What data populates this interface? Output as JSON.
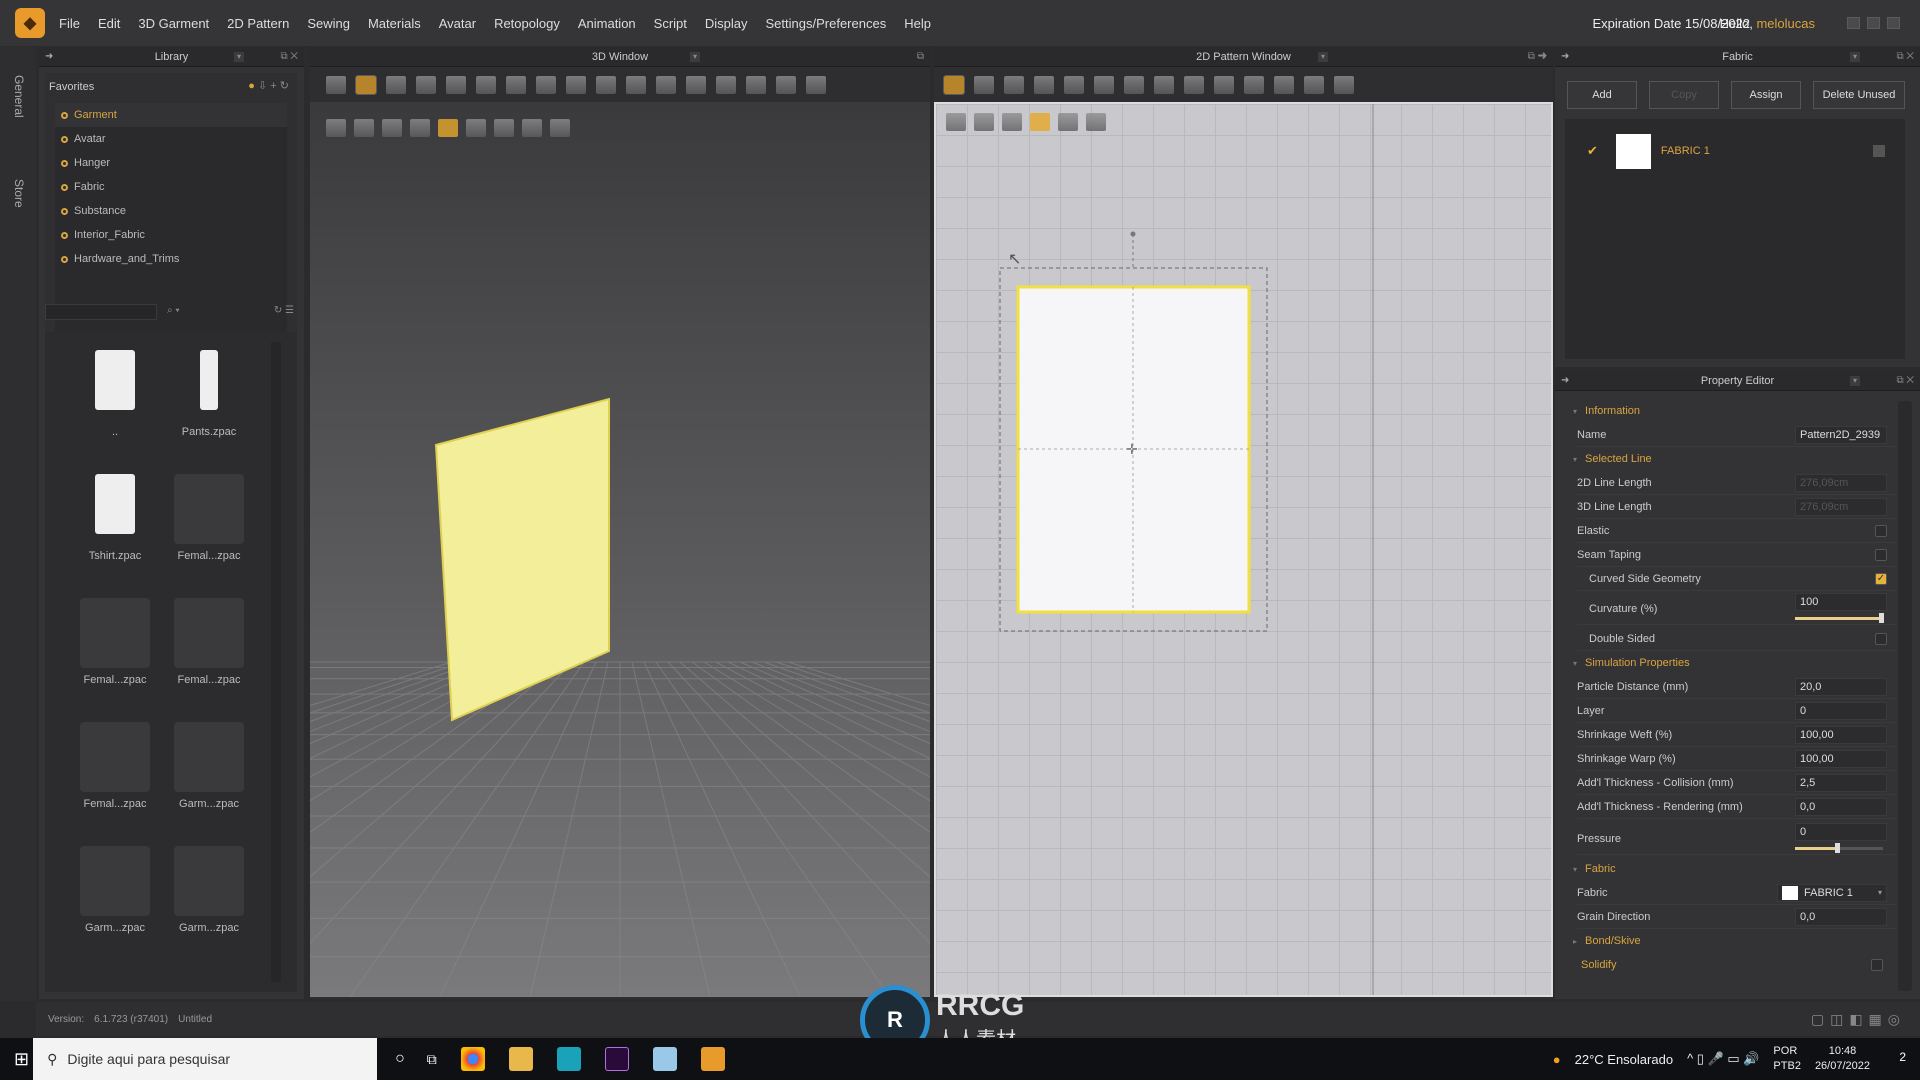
{
  "menubar": {
    "items": [
      "File",
      "Edit",
      "3D Garment",
      "2D Pattern",
      "Sewing",
      "Materials",
      "Avatar",
      "Retopology",
      "Animation",
      "Script",
      "Display",
      "Settings/Preferences",
      "Help"
    ],
    "expiration": "Expiration Date 15/08/2022",
    "hello": "Hello,",
    "username": "melolucas"
  },
  "sidetabs": {
    "general": "General",
    "store": "Store"
  },
  "library": {
    "title": "Library",
    "favorites_label": "Favorites",
    "favorites": [
      "Garment",
      "Avatar",
      "Hanger",
      "Fabric",
      "Substance",
      "Interior_Fabric",
      "Hardware_and_Trims"
    ],
    "selected_favorite": "Garment",
    "search_value": "",
    "items": [
      "..",
      "Pants.zpac",
      "Tshirt.zpac",
      "Femal...zpac",
      "Femal...zpac",
      "Femal...zpac",
      "Femal...zpac",
      "Garm...zpac",
      "Garm...zpac",
      "Garm...zpac"
    ]
  },
  "window3d": {
    "title": "3D Window",
    "toolbar1": [
      "move-down-icon",
      "transform-icon",
      "edit-point-icon",
      "edit-curve-icon",
      "fold-arrangement-icon",
      "select-mesh-icon",
      "tack-icon",
      "fold-icon",
      "strap-icon",
      "pin-icon",
      "box-pin-icon",
      "button-icon",
      "buttonhole-icon",
      "zipper-icon",
      "measure-icon",
      "avatar-measure-icon",
      "pose-icon"
    ],
    "toolbar2": [
      "texture-icon",
      "garment-icon",
      "arrangement-icon",
      "avatar-icon",
      "fabric-icon",
      "thickness-icon",
      "silhouette-icon",
      "world-icon",
      "export-icon"
    ],
    "pattern_color": "#f2ee9a"
  },
  "window2d": {
    "title": "2D Pattern Window",
    "toolbar1": [
      "transform-pattern-icon",
      "edit-point-icon",
      "rectangle-icon",
      "polygon-icon",
      "internal-shape-icon",
      "segment-sewing-icon",
      "free-sewing-icon",
      "tape-icon",
      "dart-icon",
      "pleat-icon",
      "fold-icon",
      "gusset-icon",
      "notch-icon",
      "shirt-icon"
    ],
    "toolbar2": [
      "pen-icon",
      "hide-icon",
      "zoom-icon",
      "fabric-icon",
      "grid-icon",
      "export-icon"
    ],
    "pattern_outline_color": "#f0e040"
  },
  "fabric": {
    "title": "Fabric",
    "buttons": {
      "add": "Add",
      "copy": "Copy",
      "assign": "Assign",
      "delete_unused": "Delete Unused"
    },
    "items": [
      {
        "name": "FABRIC 1",
        "selected": true,
        "swatch": "#ffffff"
      }
    ]
  },
  "property_editor": {
    "title": "Property Editor",
    "sections": {
      "information": "Information",
      "selected_line": "Selected Line",
      "simulation": "Simulation Properties",
      "fabric": "Fabric",
      "bond": "Bond/Skive",
      "solidify": "Solidify"
    },
    "name_label": "Name",
    "name_value": "Pattern2D_2939",
    "line2d_label": "2D Line Length",
    "line2d_value": "276,09cm",
    "line3d_label": "3D Line Length",
    "line3d_value": "276,09cm",
    "elastic_label": "Elastic",
    "elastic": false,
    "seam_taping_label": "Seam Taping",
    "seam_taping": false,
    "curved_label": "Curved Side Geometry",
    "curved": true,
    "curvature_label": "Curvature (%)",
    "curvature_value": "100",
    "curvature_pct": 100,
    "double_sided_label": "Double Sided",
    "double_sided": false,
    "particle_label": "Particle Distance (mm)",
    "particle_value": "20,0",
    "layer_label": "Layer",
    "layer_value": "0",
    "weft_label": "Shrinkage Weft (%)",
    "weft_value": "100,00",
    "warp_label": "Shrinkage Warp (%)",
    "warp_value": "100,00",
    "collision_label": "Add'l Thickness - Collision (mm)",
    "collision_value": "2,5",
    "rendering_label": "Add'l Thickness - Rendering (mm)",
    "rendering_value": "0,0",
    "pressure_label": "Pressure",
    "pressure_value": "0",
    "pressure_pct": 50,
    "fabric_label": "Fabric",
    "fabric_value": "FABRIC 1",
    "grain_label": "Grain Direction",
    "grain_value": "0,0",
    "solidify": false
  },
  "statusbar": {
    "version_label": "Version:",
    "version": "6.1.723 (r37401)",
    "file": "Untitled"
  },
  "taskbar": {
    "search_placeholder": "Digite aqui para pesquisar",
    "weather": "22°C  Ensolarado",
    "lang1": "POR",
    "lang2": "PTB2",
    "time": "10:48",
    "date": "26/07/2022",
    "notifications": "2"
  },
  "watermark": {
    "brand": "RRCG",
    "sub": "人人素材"
  },
  "colors": {
    "accent": "#d9a441",
    "panel": "#333335",
    "grid2d": "#c9c9cd"
  }
}
